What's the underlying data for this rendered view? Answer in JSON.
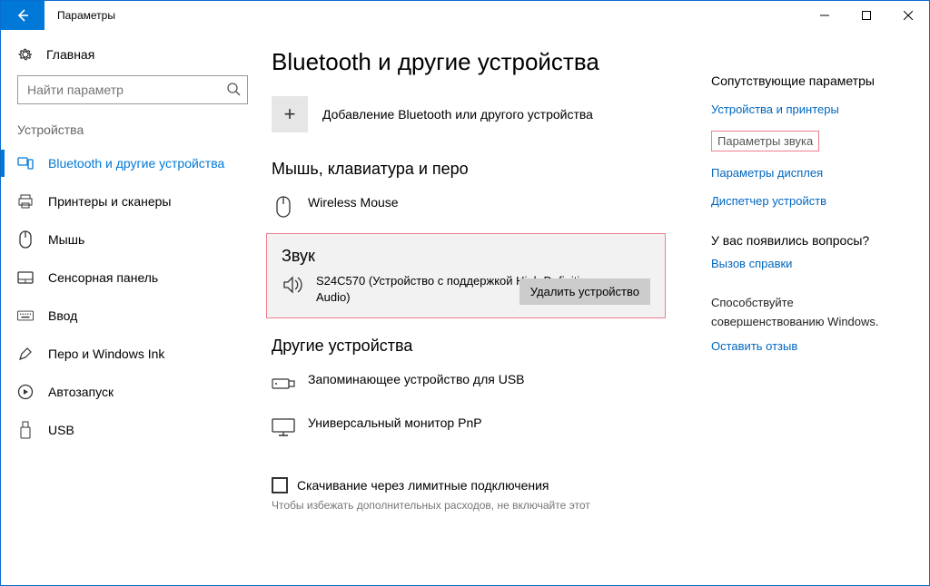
{
  "window": {
    "title": "Параметры"
  },
  "sidebar": {
    "home": "Главная",
    "search_placeholder": "Найти параметр",
    "section": "Устройства",
    "items": [
      {
        "label": "Bluetooth и другие устройства"
      },
      {
        "label": "Принтеры и сканеры"
      },
      {
        "label": "Мышь"
      },
      {
        "label": "Сенсорная панель"
      },
      {
        "label": "Ввод"
      },
      {
        "label": "Перо и Windows Ink"
      },
      {
        "label": "Автозапуск"
      },
      {
        "label": "USB"
      }
    ]
  },
  "main": {
    "title": "Bluetooth и другие устройства",
    "add_label": "Добавление Bluetooth или другого устройства",
    "mouse_section": "Мышь, клавиатура и перо",
    "mouse_device": "Wireless Mouse",
    "sound_section": "Звук",
    "sound_device": "S24C570 (Устройство с поддержкой High Definition Audio)",
    "remove_label": "Удалить устройство",
    "other_section": "Другие устройства",
    "usb_storage": "Запоминающее устройство для USB",
    "pnp_monitor": "Универсальный монитор PnP",
    "metered_label": "Скачивание через лимитные подключения",
    "metered_hint": "Чтобы избежать дополнительных расходов, не включайте этот"
  },
  "aside": {
    "related": "Сопутствующие параметры",
    "devices_printers": "Устройства и принтеры",
    "sound_settings": "Параметры звука",
    "display_settings": "Параметры дисплея",
    "device_manager": "Диспетчер устройств",
    "questions": "У вас появились вопросы?",
    "help": "Вызов справки",
    "contribute1": "Способствуйте",
    "contribute2": "совершенствованию Windows.",
    "feedback": "Оставить отзыв"
  }
}
